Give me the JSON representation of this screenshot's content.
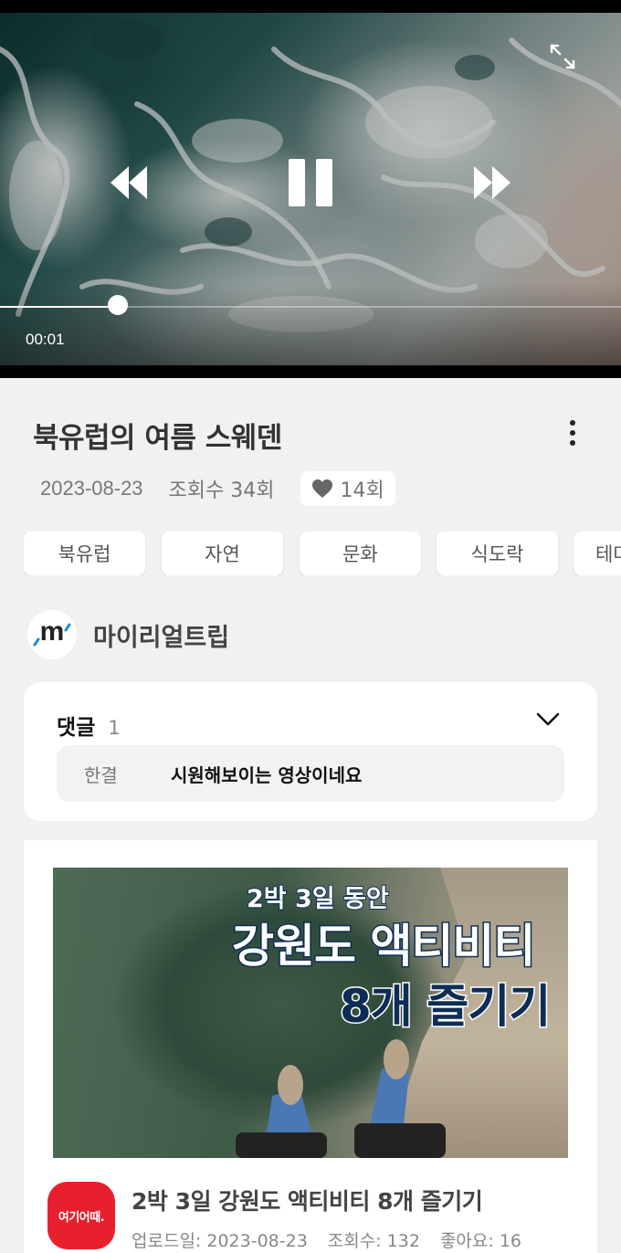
{
  "player": {
    "current_time": "00:01",
    "progress_fraction": 0.19,
    "icons": {
      "rewind": "rewind-icon",
      "pause": "pause-icon",
      "forward": "fast-forward-icon",
      "fullscreen": "fullscreen-icon"
    }
  },
  "video": {
    "title": "북유럽의 여름 스웨덴",
    "date": "2023-08-23",
    "views": "조회수 34회",
    "likes": "14회",
    "tags": [
      "북유럽",
      "자연",
      "문화",
      "식도락",
      "테마"
    ]
  },
  "channel": {
    "name": "마이리얼트립",
    "logo_text": "m",
    "accent": "#1a8fd1"
  },
  "comments": {
    "title": "댓글",
    "count": "1",
    "preview_author": "한결",
    "preview_text": "시원해보이는 영상이네요"
  },
  "recommended": {
    "thumb_subtitle": "2박 3일 동안",
    "thumb_line1": "강원도 액티비티",
    "thumb_line2": "8개 즐기기",
    "logo_text": "여기어때.",
    "title": "2박 3일 강원도 액티비티 8개 즐기기",
    "upload": "업로드일: 2023-08-23",
    "views": "조회수: 132",
    "likes": "좋아요: 16",
    "brand_color": "#e8202e"
  }
}
